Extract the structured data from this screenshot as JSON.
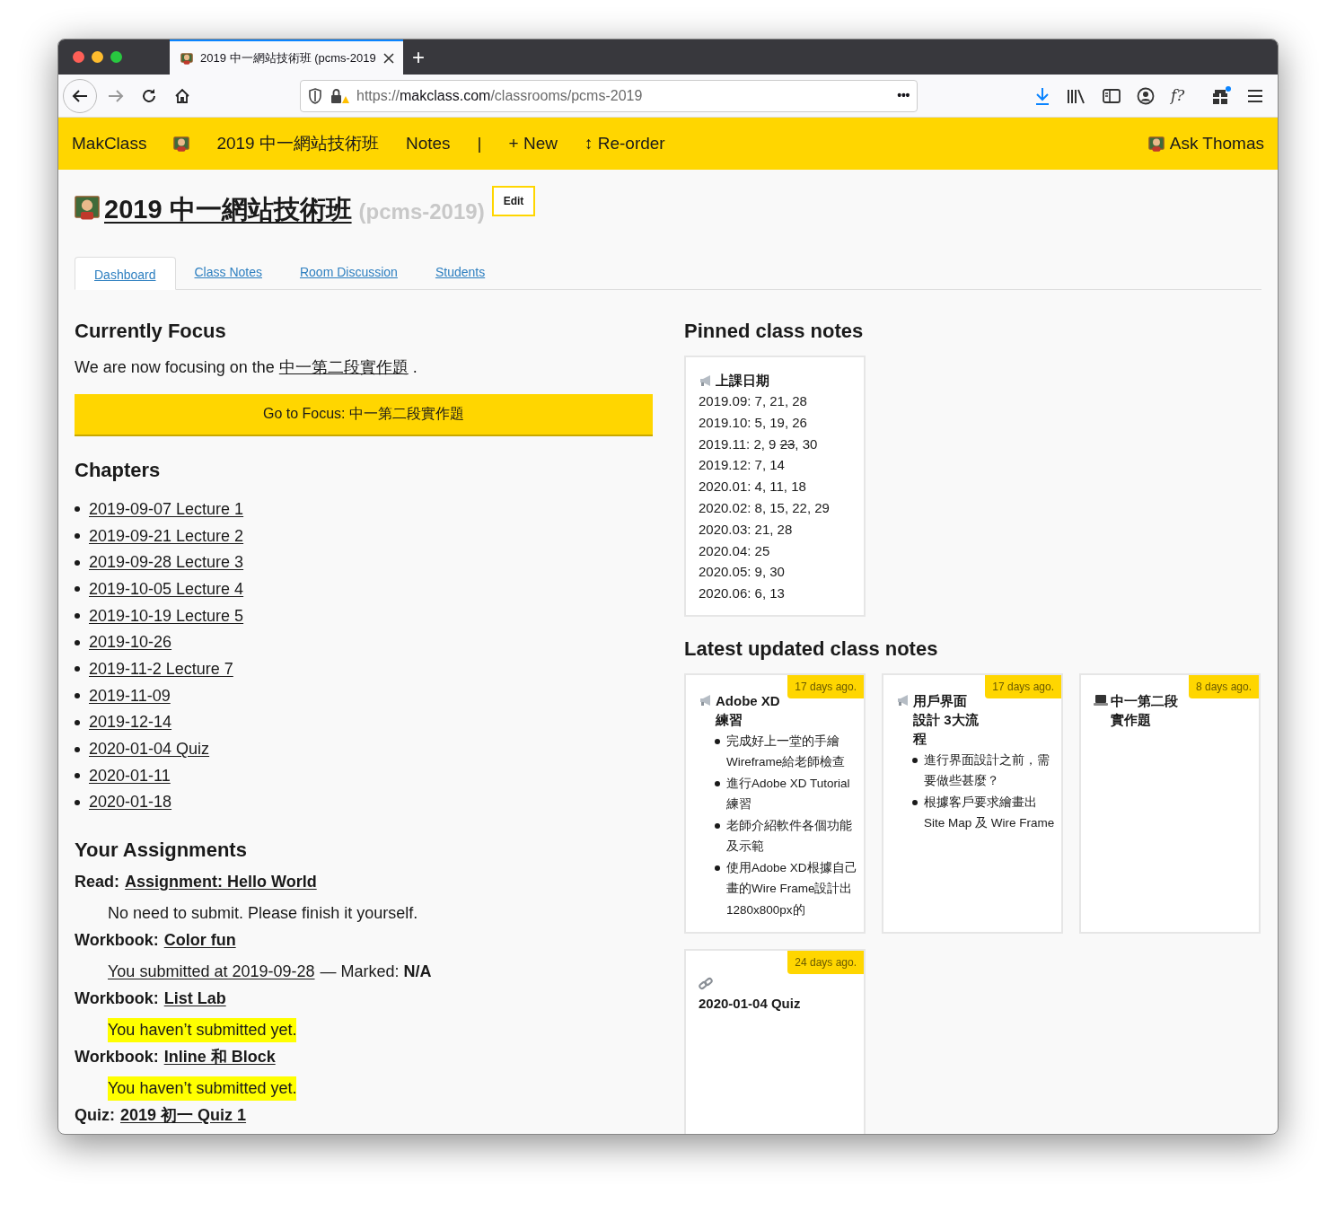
{
  "browser": {
    "tab_title": "2019 中一網站技術班 (pcms-2019",
    "new_tab": "+",
    "url": {
      "scheme": "https://",
      "host": "makclass.com",
      "path": "/classrooms/pcms-2019"
    },
    "page_actions": "•••",
    "function_button": "f?"
  },
  "nav": {
    "brand": "MakClass",
    "items": [
      "2019 中一網站技術班",
      "Notes",
      "|",
      "+ New",
      "↕ Re-order"
    ],
    "user": "Ask Thomas"
  },
  "header": {
    "title": "2019 中一網站技術班",
    "slug": "(pcms-2019)",
    "edit": "Edit"
  },
  "tabs": [
    {
      "label": "Dashboard",
      "selected": true
    },
    {
      "label": "Class Notes",
      "selected": false
    },
    {
      "label": "Room Discussion",
      "selected": false
    },
    {
      "label": "Students",
      "selected": false
    }
  ],
  "focus": {
    "heading": "Currently Focus",
    "text_before": "We are now focusing on the",
    "link": "中一第二段實作題",
    "text_after": ".",
    "button": "Go to Focus: 中一第二段實作題"
  },
  "chapters": {
    "heading": "Chapters",
    "items": [
      "2019-09-07 Lecture 1",
      "2019-09-21 Lecture 2",
      "2019-09-28 Lecture 3",
      "2019-10-05 Lecture 4",
      "2019-10-19 Lecture 5",
      "2019-10-26",
      "2019-11-2 Lecture 7",
      "2019-11-09",
      "2019-12-14",
      "2020-01-04 Quiz",
      "2020-01-11",
      "2020-01-18"
    ]
  },
  "assignments": {
    "heading": "Your Assignments",
    "items": [
      {
        "label": "Read:",
        "link": "Assignment: Hello World",
        "note": {
          "kind": "plain",
          "text": "No need to submit. Please finish it yourself."
        }
      },
      {
        "label": "Workbook:",
        "link": "Color fun",
        "note": {
          "kind": "submitted",
          "link": "You submitted at 2019-09-28",
          "text": "— Marked: **N/A**"
        }
      },
      {
        "label": "Workbook:",
        "link": "List Lab",
        "note": {
          "kind": "warning",
          "text": "You haven’t submitted yet."
        }
      },
      {
        "label": "Workbook:",
        "link": "Inline 和 Block",
        "note": {
          "kind": "warning",
          "text": "You haven’t submitted yet."
        }
      },
      {
        "label": "Quiz:",
        "link": "2019 初一 Quiz 1"
      }
    ]
  },
  "pinned": {
    "heading": "Pinned class notes",
    "title": "上課日期",
    "lines": [
      {
        "parts": [
          {
            "text": "2019.09: 7, 21, 28",
            "struck": false
          }
        ]
      },
      {
        "parts": [
          {
            "text": "2019.10: 5, 19, 26",
            "struck": false
          }
        ]
      },
      {
        "parts": [
          {
            "text": "2019.11: 2, 9 ",
            "struck": false
          },
          {
            "text": "23",
            "struck": true
          },
          {
            "text": ", 30",
            "struck": false
          }
        ]
      },
      {
        "parts": [
          {
            "text": "2019.12: 7, 14",
            "struck": false
          }
        ]
      },
      {
        "parts": [
          {
            "text": "2020.01: 4, 11, 18",
            "struck": false
          }
        ]
      },
      {
        "parts": [
          {
            "text": "2020.02: 8, 15, 22, 29",
            "struck": false
          }
        ]
      },
      {
        "parts": [
          {
            "text": "2020.03: 21, 28",
            "struck": false
          }
        ]
      },
      {
        "parts": [
          {
            "text": "2020.04: 25",
            "struck": false
          }
        ]
      },
      {
        "parts": [
          {
            "text": "2020.05: 9, 30",
            "struck": false
          }
        ]
      },
      {
        "parts": [
          {
            "text": "2020.06: 6, 13",
            "struck": false
          }
        ]
      }
    ]
  },
  "latest": {
    "heading": "Latest updated class notes",
    "cards": [
      {
        "kind": "megaphone",
        "title": "Adobe XD 練習",
        "age": "17 days ago.",
        "bullets": [
          "完成好上一堂的手繪Wireframe給老師檢查",
          "進行Adobe XD Tutorial 練習",
          "老師介紹軟件各個功能及示範",
          "使用Adobe XD根據自己畫的Wire Frame設計出1280x800px的"
        ]
      },
      {
        "kind": "megaphone",
        "title": "用戶界面設計 3大流程",
        "age": "17 days ago.",
        "bullets": [
          "進行界面設計之前，需要做些甚麼？",
          "根據客戶要求繪畫出Site Map 及 Wire Frame"
        ]
      },
      {
        "kind": "laptop",
        "title": "中一第二段實作題",
        "age": "8 days ago."
      },
      {
        "kind": "link",
        "title": "2020-01-04 Quiz",
        "age": "24 days ago."
      }
    ]
  }
}
